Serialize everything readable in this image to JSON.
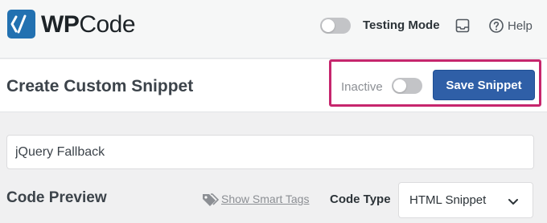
{
  "header": {
    "logo": {
      "brand_bold": "WP",
      "brand_regular": "Code"
    },
    "testing_mode": {
      "label": "Testing Mode",
      "enabled": false
    },
    "help_label": "Help"
  },
  "title_bar": {
    "title": "Create Custom Snippet",
    "status": {
      "label": "Inactive",
      "active": false
    },
    "save_label": "Save Snippet",
    "highlight_color": "#c6266d",
    "accent_color": "#2f5fa7"
  },
  "snippet": {
    "name_value": "jQuery Fallback"
  },
  "code_preview": {
    "title": "Code Preview",
    "smart_tags_link": "Show Smart Tags",
    "code_type_label": "Code Type",
    "code_type_value": "HTML Snippet"
  }
}
